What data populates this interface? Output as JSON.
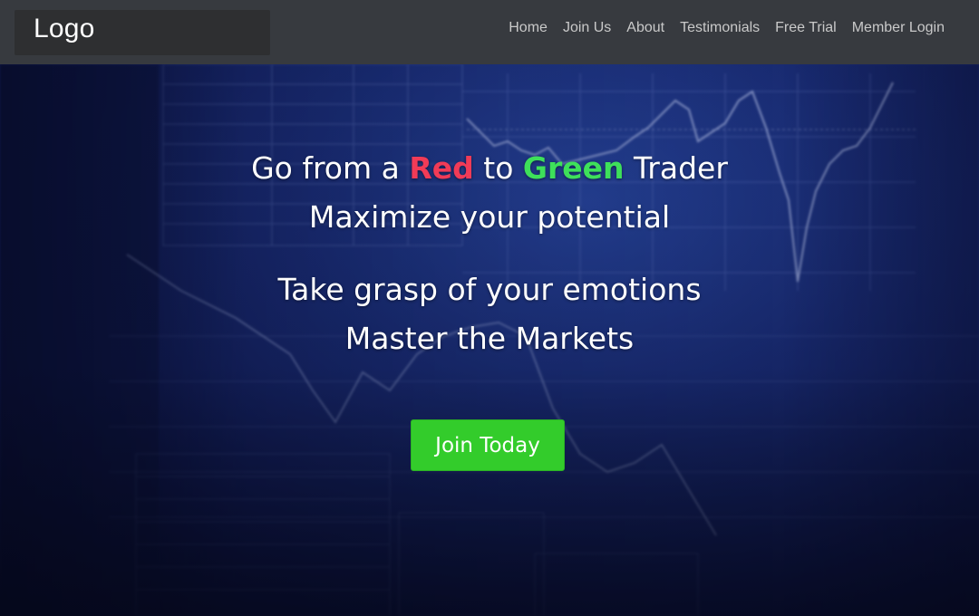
{
  "header": {
    "logo": "Logo",
    "nav": [
      {
        "label": "Home"
      },
      {
        "label": "Join Us"
      },
      {
        "label": "About"
      },
      {
        "label": "Testimonials"
      },
      {
        "label": "Free Trial"
      },
      {
        "label": "Member Login"
      }
    ]
  },
  "hero": {
    "line1": {
      "prefix": "Go from a ",
      "red_word": "Red",
      "middle": " to ",
      "green_word": "Green",
      "suffix": " Trader"
    },
    "line2": "Maximize your potential",
    "line3": "Take grasp of your emotions",
    "line4": "Master the Markets",
    "cta_label": "Join Today",
    "background_image": "trading-screen-charts"
  },
  "colors": {
    "topbar": "#373a3f",
    "red_word": "#f13b57",
    "green_word": "#3ee05a",
    "cta": "#33cc2b",
    "hero_blue": "#1b2f7c"
  }
}
